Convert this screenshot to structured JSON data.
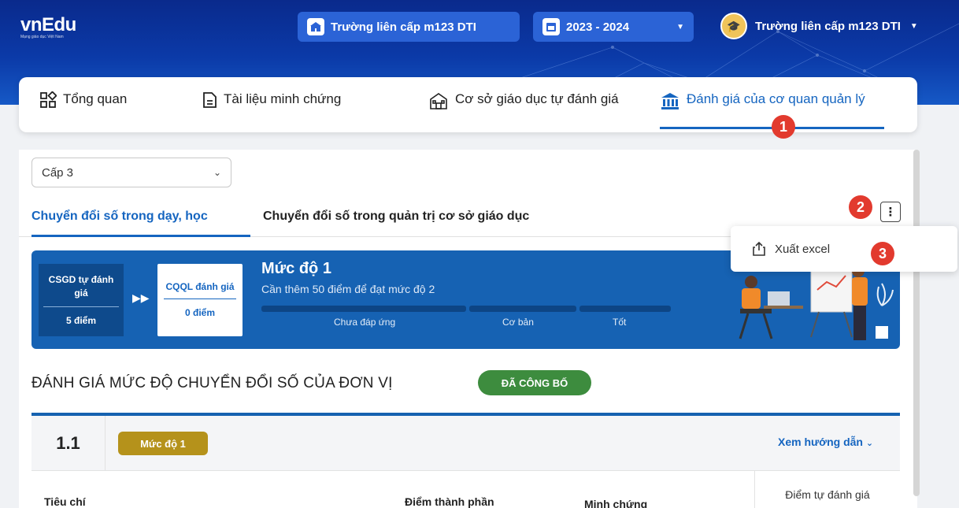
{
  "header": {
    "logo_text": "vnEdu",
    "logo_tagline": "Mạng giáo dục Việt Nam",
    "school_selector": "Trường liên cấp m123 DTI",
    "year_selector": "2023 - 2024",
    "user_name": "Trường liên cấp m123 DTI"
  },
  "main_tabs": [
    {
      "label": "Tổng quan",
      "icon": "grid-icon"
    },
    {
      "label": "Tài liệu minh chứng",
      "icon": "document-icon"
    },
    {
      "label": "Cơ sở giáo dục tự đánh giá",
      "icon": "school-icon"
    },
    {
      "label": "Đánh giá của cơ quan quản lý",
      "icon": "bank-icon",
      "active": true
    }
  ],
  "markers": {
    "one": "1",
    "two": "2",
    "three": "3"
  },
  "level_select": {
    "value": "Cấp 3"
  },
  "sub_tabs": [
    {
      "label": "Chuyển đổi số trong dạy, học",
      "active": true
    },
    {
      "label": "Chuyển đổi số trong quản trị cơ sở giáo dục"
    }
  ],
  "menu": {
    "more_icon": "⋮",
    "export_label": "Xuất excel"
  },
  "banner": {
    "self_title": "CSGD tự đánh giá",
    "self_points": "5 điểm",
    "mgr_title": "CQQL đánh giá",
    "mgr_points": "0 điểm",
    "level_title": "Mức độ 1",
    "level_sub": "Cần thêm 50 điểm để đạt mức độ 2",
    "bar_labels": [
      "Chưa đáp ứng",
      "Cơ bản",
      "Tốt"
    ]
  },
  "section": {
    "title": "ĐÁNH GIÁ MỨC ĐỘ CHUYỂN ĐỔI SỐ CỦA ĐƠN VỊ",
    "status": "ĐÃ CÔNG BỐ"
  },
  "criteria": {
    "number": "1.1",
    "level": "Mức độ 1",
    "guide": "Xem hướng dẫn",
    "col_criterion": "Tiêu chí",
    "col_component": "Điểm thành phần",
    "col_evidence": "Minh chứng",
    "col_self_score": "Điểm tự đánh giá"
  },
  "colors": {
    "primary": "#1565c0",
    "header": "#0b3aa8",
    "banner": "#1662b3",
    "published": "#3d8c3e",
    "level_badge": "#b5921b",
    "marker": "#e23a2e"
  }
}
